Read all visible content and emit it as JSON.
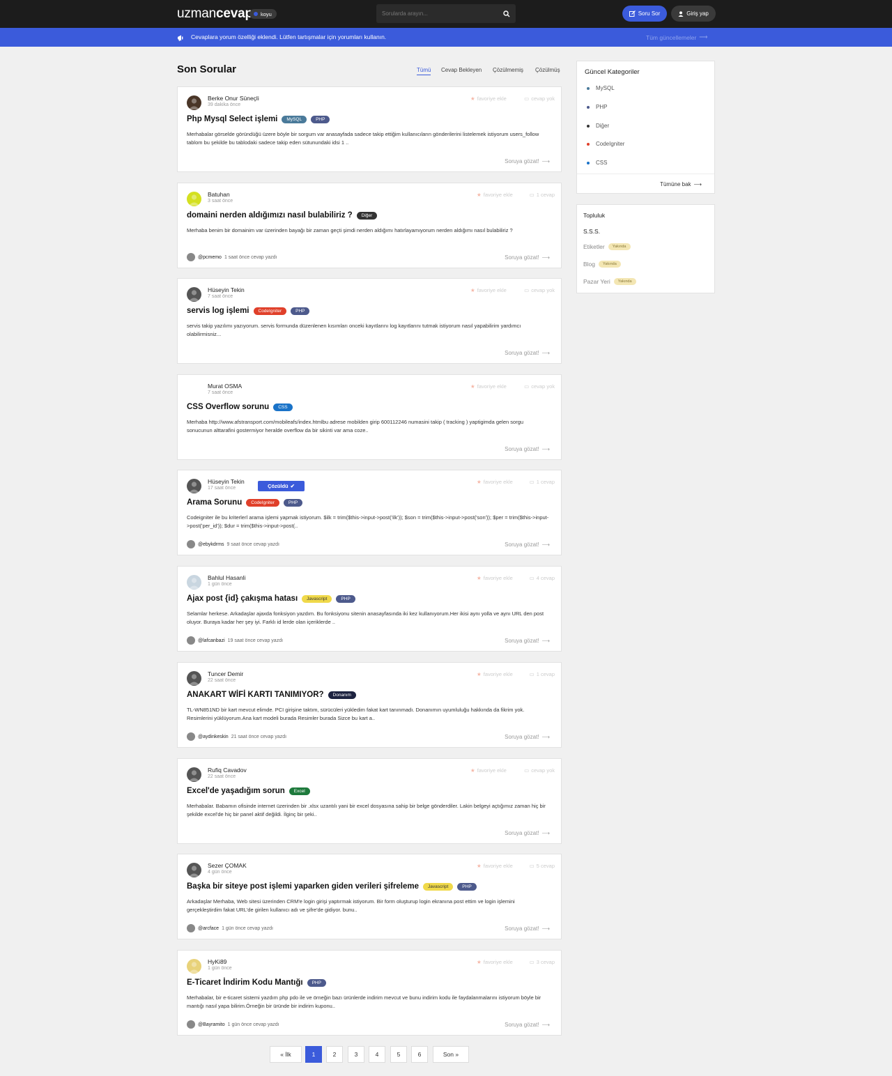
{
  "header": {
    "logo_light": "uzman",
    "logo_bold": "cevap",
    "theme_label": "koyu",
    "search_placeholder": "Sorularda arayın...",
    "ask_label": "Soru Sor",
    "login_label": "Giriş yap"
  },
  "announcement": {
    "text": "Cevaplara yorum özelliği eklendi. Lütfen tartışmalar için yorumları kullanın.",
    "link": "Tüm güncellemeler"
  },
  "main": {
    "title": "Son Sorular",
    "filters": [
      "Tümü",
      "Cevap Bekleyen",
      "Çözülmemiş",
      "Çözülmüş"
    ],
    "fav_label": "favoriye ekle",
    "browse_label": "Soruya gözat!",
    "solved_label": "Çözüldü"
  },
  "questions": [
    {
      "author": "Berke Onur Süneçli",
      "time": "39 dakika önce",
      "answers": "cevap yok",
      "title": "Php Mysql Select işlemi",
      "tags": [
        {
          "name": "MySQL",
          "color": "#4a7a9a"
        },
        {
          "name": "PHP",
          "color": "#4d5a8c"
        }
      ],
      "excerpt": "Merhabalar görselde göründüğü üzere böyle bir sorgum var anasayfada sadece takip ettiğim kullanıcıların gönderilerini listelemek istiyorum users_follow tablom bu şekilde bu tablodaki sadece takip eden sütunundaki idsi 1 ..",
      "replier": "",
      "reply_time": "",
      "solved": false,
      "avatar_color": "#4a3628"
    },
    {
      "author": "Batuhan",
      "time": "3 saat önce",
      "answers": "1 cevap",
      "title": "domaini nerden aldığımızı nasıl bulabiliriz ?",
      "tags": [
        {
          "name": "Diğer",
          "color": "#333333"
        }
      ],
      "excerpt": "Merhaba benim bir domainim var üzerinden bayağı bir zaman geçti şimdi nerden aldığımı hatırlayamıyorum nerden aldığımı nasıl bulabiliriz ?",
      "replier": "@pcmemo",
      "reply_time": "1 saat önce cevap yazdı",
      "solved": false,
      "avatar_color": "#d4e021"
    },
    {
      "author": "Hüseyin Tekin",
      "time": "7 saat önce",
      "answers": "cevap yok",
      "title": "servis log işlemi",
      "tags": [
        {
          "name": "CodeIgniter",
          "color": "#e0402a"
        },
        {
          "name": "PHP",
          "color": "#4d5a8c"
        }
      ],
      "excerpt": "servis takip yazılımı yazıyorum. servis formunda düzenlenen kısımları onceki kayıtlarını log kayıtlarını tutmak istiyorum nasıl yapabilirim yardımcı olabilirmisniz...",
      "replier": "",
      "reply_time": "",
      "solved": false,
      "avatar_color": "#555555"
    },
    {
      "author": "Murat OSMA",
      "time": "7 saat önce",
      "answers": "cevap yok",
      "title": "CSS Overflow sorunu",
      "tags": [
        {
          "name": "CSS",
          "color": "#1a73c8"
        }
      ],
      "excerpt": "Merhaba http://www.afstransport.com/mobileafs/index.htmlbu adrese mobilden girip 600112246 numasini takip ( tracking ) yaptigimda gelen sorgu sonucunun alttarafini gostermiyor heralde overflow da bir sikinti var ama coze..",
      "replier": "",
      "reply_time": "",
      "solved": false,
      "avatar_color": "#ffffff"
    },
    {
      "author": "Hüseyin Tekin",
      "time": "17 saat önce",
      "answers": "1 cevap",
      "title": "Arama Sorunu",
      "tags": [
        {
          "name": "CodeIgniter",
          "color": "#e0402a"
        },
        {
          "name": "PHP",
          "color": "#4d5a8c"
        }
      ],
      "excerpt": "Codeigniter ile bu kriterlerl arama işlemi yapmak istiyorum. $ilk = trim($this->input->post('ilk')); $son = trim($this->input->post('son')); $per = trim($this->input->post('per_id')); $dur = trim($this->input->post(..",
      "replier": "@ebykdrms",
      "reply_time": "9 saat önce cevap yazdı",
      "solved": true,
      "avatar_color": "#555555"
    },
    {
      "author": "Bahlul Hasanli",
      "time": "1 gün önce",
      "answers": "4 cevap",
      "title": "Ajax post {id} çakışma hatası",
      "tags": [
        {
          "name": "Javascript",
          "color": "#f0d94a"
        },
        {
          "name": "PHP",
          "color": "#4d5a8c"
        }
      ],
      "excerpt": "Selamlar herkese. Arkadaşlar ajaxda fonksiyon yazdım. Bu fonksiyonu sitenin anasayfasında iki kez kullanıyorum.Her ikisi aynı yolla ve aynı URL den post oluyor. Buraya kadar her şey iyi. Farklı id lerde olan içeriklerde ..",
      "replier": "@lafcanbazi",
      "reply_time": "19 saat önce cevap yazdı",
      "solved": false,
      "avatar_color": "#c9d6e0"
    },
    {
      "author": "Tuncer Demir",
      "time": "22 saat önce",
      "answers": "1 cevap",
      "title": "ANAKART WİFİ KARTI TANIMIYOR?",
      "tags": [
        {
          "name": "Donanım",
          "color": "#1d2340"
        }
      ],
      "excerpt": "TL-WN851ND bir kart mevcut elimde. PCI girişine taktım, sürücüleri yükledim fakat kart tanınmadı. Donanımın uyumluluğu hakkında da fikrim yok. Resimlerini yüklüyorum.Ana kart modeli burada Resimler burada Sizce bu kart a..",
      "replier": "@aydinkeskin",
      "reply_time": "21 saat önce cevap yazdı",
      "solved": false,
      "avatar_color": "#555555"
    },
    {
      "author": "Rufiq Cavadov",
      "time": "22 saat önce",
      "answers": "cevap yok",
      "title": "Excel'de yaşadığım sorun",
      "tags": [
        {
          "name": "Excel",
          "color": "#1e7a3c"
        }
      ],
      "excerpt": "Merhabalar. Babamın ofisinde internet üzerinden bir .xlsx uzantılı yani bir excel dosyasına sahip bir belge gönderdiler. Lakin belgeyi açtığımız zaman hiç bir şekilde excel'de hiç bir panel aktif değildi. İlginç bir şeki..",
      "replier": "",
      "reply_time": "",
      "solved": false,
      "avatar_color": "#555555"
    },
    {
      "author": "Sezer ÇOMAK",
      "time": "4 gün önce",
      "answers": "5 cevap",
      "title": "Başka bir siteye post işlemi yaparken giden verileri şifreleme",
      "tags": [
        {
          "name": "Javascript",
          "color": "#f0d94a"
        },
        {
          "name": "PHP",
          "color": "#4d5a8c"
        }
      ],
      "excerpt": "Arkadaşlar Merhaba, Web sitesi üzerinden CRM'e login girişi yaptırmak istiyorum. Bir form oluşturup login ekranına post ettim ve login işlemini gerçekleştirdim fakat URL'de girilen kullanıcı adı ve şifre'de gidiyor. bunu..",
      "replier": "@arcface",
      "reply_time": "1 gün önce cevap yazdı",
      "solved": false,
      "avatar_color": "#555555"
    },
    {
      "author": "HyKi89",
      "time": "1 gün önce",
      "answers": "3 cevap",
      "title": "E-Ticaret İndirim Kodu Mantığı",
      "tags": [
        {
          "name": "PHP",
          "color": "#4d5a8c"
        }
      ],
      "excerpt": "Merhabalar, bir e-ticaret sistemi yazdım php pdo ile ve örneğin bazı ürünlerde indirim mevcut ve bunu indirim kodu ile faydalanmalarını istiyorum böyle bir mantığı nasıl yapa bilirim.Örneğin bir üründe bir indirim kuponu..",
      "replier": "@Bayramito",
      "reply_time": "1 gün önce cevap yazdı",
      "solved": false,
      "avatar_color": "#e8d27a"
    }
  ],
  "categories": {
    "title": "Güncel Kategoriler",
    "items": [
      {
        "name": "MySQL",
        "color": "#4a7a9a"
      },
      {
        "name": "PHP",
        "color": "#4d5a8c"
      },
      {
        "name": "Diğer",
        "color": "#333333"
      },
      {
        "name": "CodeIgniter",
        "color": "#e0402a"
      },
      {
        "name": "CSS",
        "color": "#1a73c8"
      }
    ],
    "more": "Tümüne bak"
  },
  "community": {
    "title": "Topluluk",
    "items": [
      {
        "name": "S.S.S.",
        "soon": ""
      },
      {
        "name": "Etiketler",
        "soon": "Yakında"
      },
      {
        "name": "Blog",
        "soon": "Yakında"
      },
      {
        "name": "Pazar Yeri",
        "soon": "Yakında"
      }
    ]
  },
  "pagination": {
    "first": "« İlk",
    "pages": [
      "1",
      "2",
      "3",
      "4",
      "5",
      "6"
    ],
    "current": "1",
    "last": "Son »"
  },
  "colors": {
    "accent": "#3b5bdb",
    "topbar": "#1c1c1c",
    "background": "#f0f0f0"
  }
}
